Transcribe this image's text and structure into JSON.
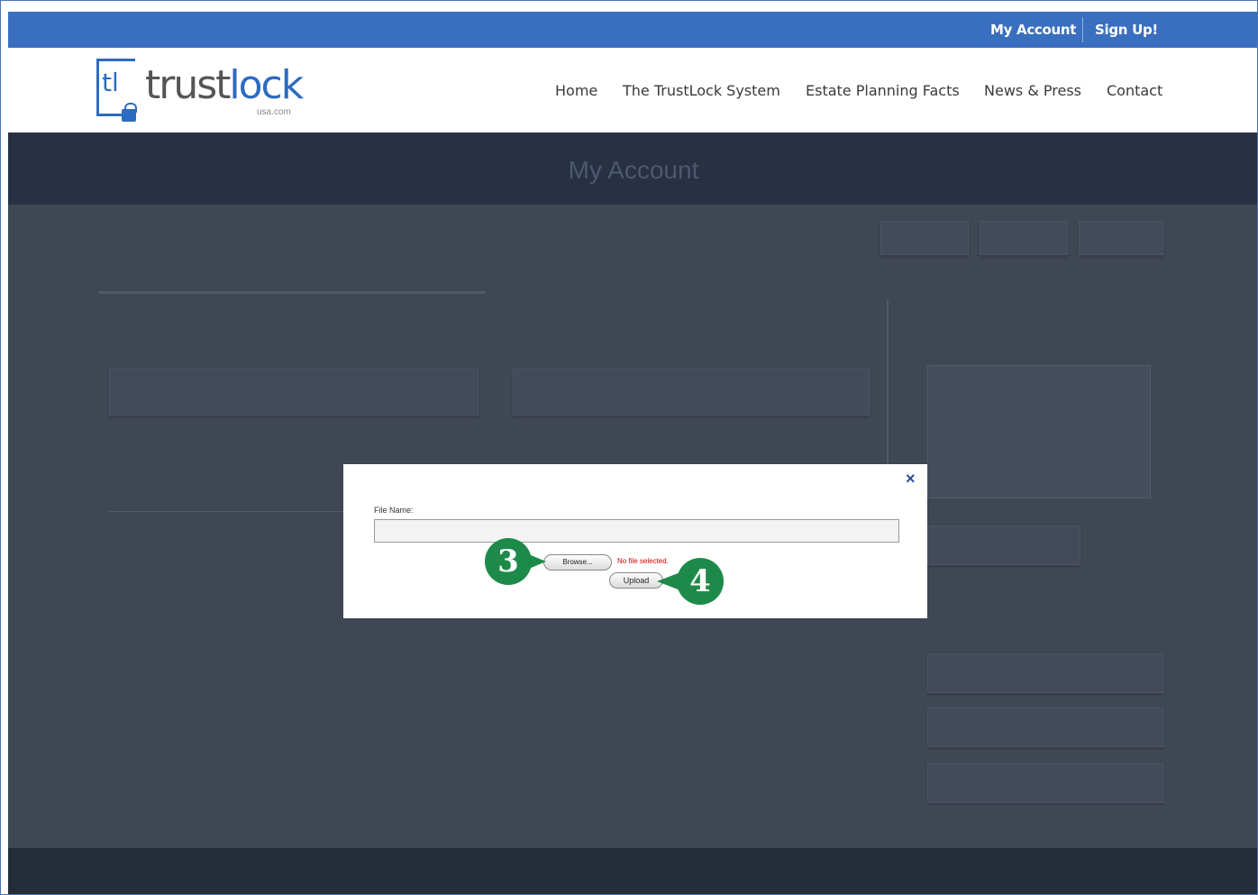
{
  "topbar": {
    "my_account": "My Account",
    "sign_up": "Sign Up!"
  },
  "header": {
    "logo": {
      "initials": "tl",
      "name_part1": "trust",
      "name_part2": "lock",
      "subtext": "usa.com"
    },
    "nav": [
      {
        "label": "Home"
      },
      {
        "label": "The TrustLock System"
      },
      {
        "label": "Estate Planning Facts"
      },
      {
        "label": "News & Press"
      },
      {
        "label": "Contact"
      }
    ]
  },
  "page": {
    "title": "My Account"
  },
  "modal": {
    "close_symbol": "×",
    "file_name_label": "File Name:",
    "file_name_value": "",
    "browse_label": "Browse...",
    "no_file_text": "No file selected.",
    "upload_label": "Upload"
  },
  "callouts": [
    {
      "label": "3"
    },
    {
      "label": "4"
    }
  ],
  "colors": {
    "topbar": "#3a6fbf",
    "brand_blue": "#2c6cc0",
    "overlay_content": "#3f4654",
    "banner": "#273143",
    "callout_green": "#1e8a4a",
    "error_red": "#d00000"
  }
}
